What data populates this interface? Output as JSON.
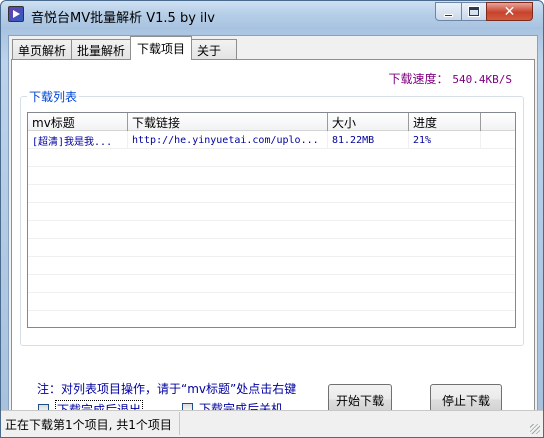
{
  "window": {
    "title": "音悦台MV批量解析 V1.5 by ilv",
    "controls": {
      "minimize": "minimize",
      "maximize": "maximize",
      "close": "✕"
    }
  },
  "tabs": [
    {
      "label": "单页解析"
    },
    {
      "label": "批量解析"
    },
    {
      "label": "下载项目",
      "active": true
    },
    {
      "label": "关于"
    }
  ],
  "speed": {
    "label": "下载速度：",
    "value": "540.4KB/S"
  },
  "download_list": {
    "legend": "下载列表",
    "columns": [
      "mv标题",
      "下载链接",
      "大小",
      "进度"
    ],
    "rows": [
      {
        "title": "[超清]我是我...",
        "link": "http://he.yinyuetai.com/uplo...",
        "size": "81.22MB",
        "progress": "21%"
      }
    ]
  },
  "note": "注：对列表项目操作，请于“mv标题”处点击右键",
  "options": {
    "exit_after": {
      "label": "下载完成后退出",
      "checked": false
    },
    "shutdown_after": {
      "label": "下载完成后关机",
      "checked": false
    }
  },
  "buttons": {
    "start": "开始下载",
    "stop": "停止下载"
  },
  "status": {
    "text": "正在下载第1个项目, 共1个项目"
  },
  "colors": {
    "accent_text": "#0000a0",
    "speed_text": "#800080",
    "legend_text": "#0046d5"
  }
}
